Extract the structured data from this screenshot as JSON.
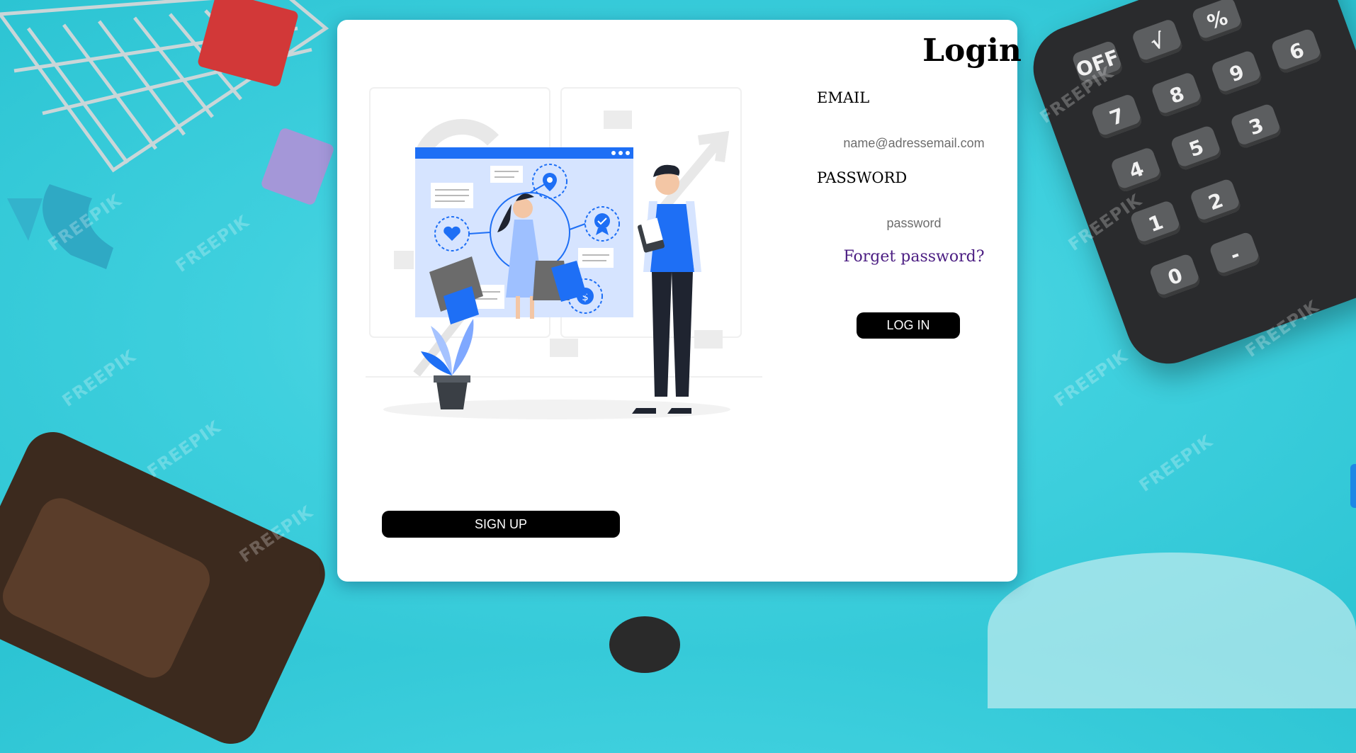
{
  "colors": {
    "background": "#3fd0de",
    "card": "#ffffff",
    "button": "#000000",
    "button_text": "#ffffff",
    "link": "#4b1d82",
    "illustration_accent": "#1e6ff5"
  },
  "background": {
    "watermark_text": "FREEPIK",
    "calculator_keys": [
      "OFF",
      "√",
      "%",
      "7",
      "8",
      "9",
      "6",
      "4",
      "5",
      "3",
      "2",
      "1",
      "0",
      "-"
    ]
  },
  "login": {
    "title": "Login",
    "email_label": "EMAIL",
    "email_placeholder": "name@adressemail.com",
    "password_label": "PASSWORD",
    "password_placeholder": "password",
    "forgot_link": "Forget password?",
    "login_button": "LOG IN",
    "signup_button": "SIGN UP"
  },
  "illustration": {
    "icons": [
      "location-pin-icon",
      "heart-icon",
      "badge-check-icon",
      "dollar-coin-icon"
    ],
    "coin_symbol": "$"
  }
}
